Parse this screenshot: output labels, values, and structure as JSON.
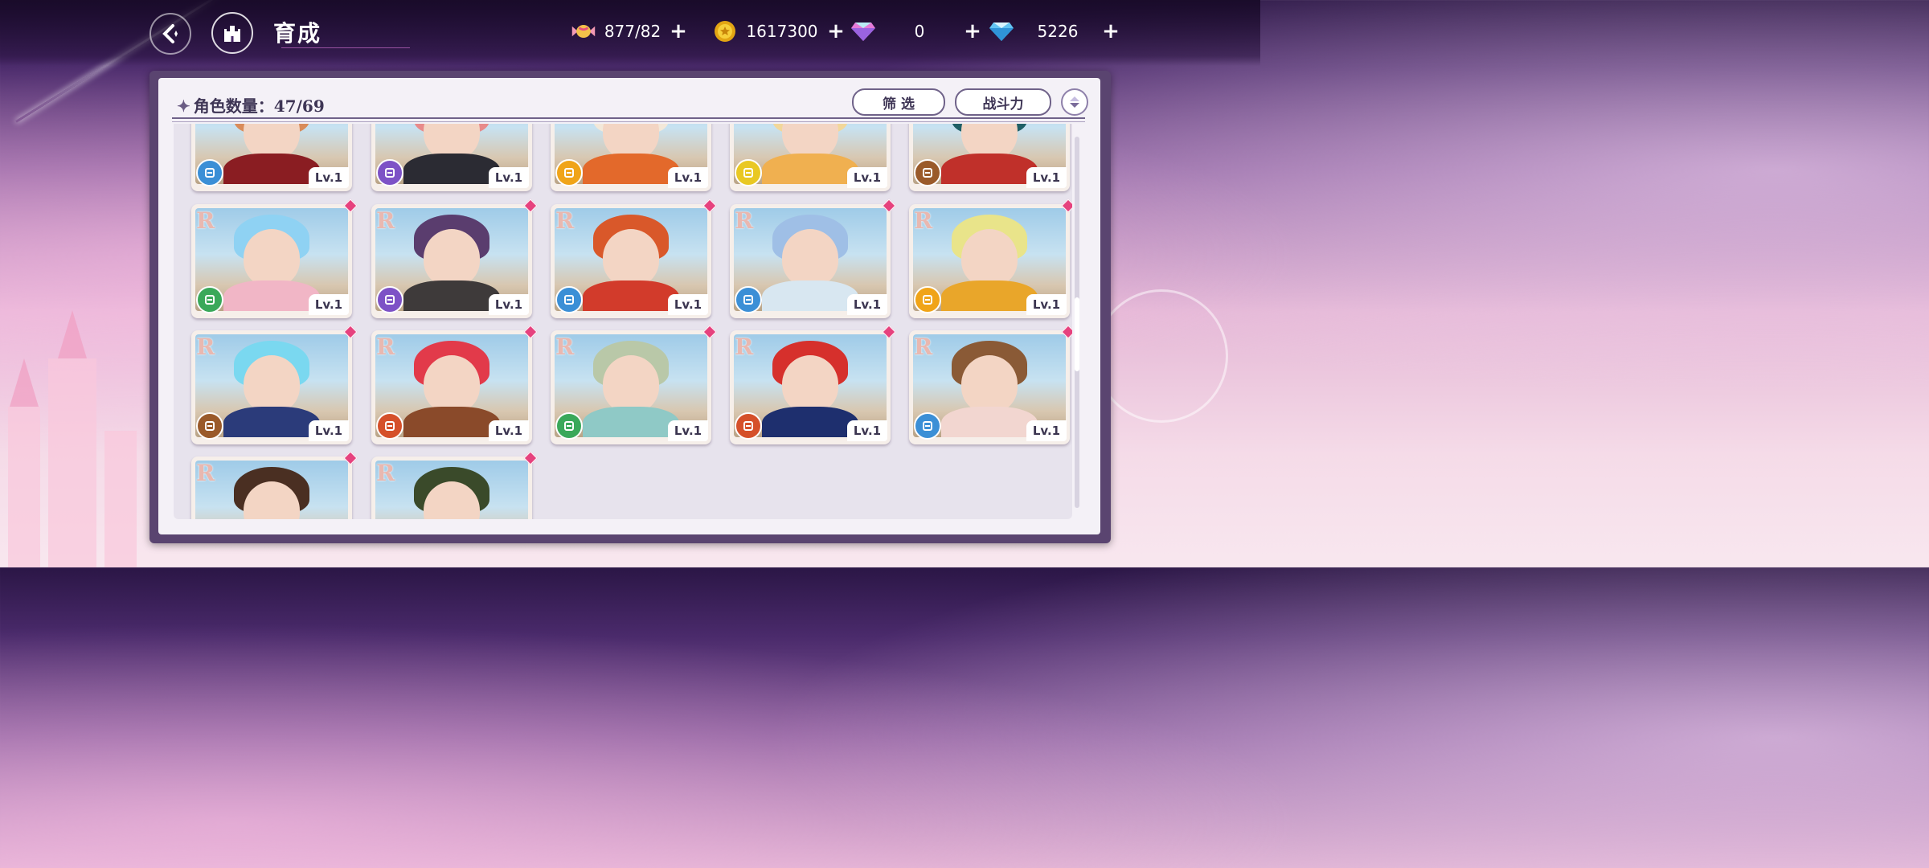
{
  "header": {
    "title": "育成",
    "resources": [
      {
        "name": "stamina",
        "icon": "candy-icon",
        "value": "877/82"
      },
      {
        "name": "gold",
        "icon": "coin-icon",
        "value": "1617300"
      },
      {
        "name": "paid_gem",
        "icon": "pink-diamond-icon",
        "value": "0"
      },
      {
        "name": "free_gem",
        "icon": "blue-diamond-icon",
        "value": "5226"
      }
    ]
  },
  "panel": {
    "count_label": "角色数量：47/69",
    "filter_label": "筛 选",
    "sort_label": "战斗力"
  },
  "cards": [
    {
      "rarity": "",
      "level": "Lv.1",
      "class_color": "#3b8fd6",
      "hair": "#d98b5a",
      "outfit": "#8a1d22",
      "new": false
    },
    {
      "rarity": "",
      "level": "Lv.1",
      "class_color": "#7d52c6",
      "hair": "#e88a8a",
      "outfit": "#2b2b33",
      "new": false
    },
    {
      "rarity": "",
      "level": "Lv.1",
      "class_color": "#f0a418",
      "hair": "#f3e8d9",
      "outfit": "#e3692b",
      "new": false
    },
    {
      "rarity": "",
      "level": "Lv.1",
      "class_color": "#e9c823",
      "hair": "#f2d79a",
      "outfit": "#f0b050",
      "new": false
    },
    {
      "rarity": "",
      "level": "Lv.1",
      "class_color": "#9a5a2a",
      "hair": "#1f5f66",
      "outfit": "#c0302a",
      "new": false
    },
    {
      "rarity": "R",
      "level": "Lv.1",
      "class_color": "#3aa85a",
      "hair": "#8fd2f3",
      "outfit": "#f1b6c6",
      "new": true
    },
    {
      "rarity": "R",
      "level": "Lv.1",
      "class_color": "#7d52c6",
      "hair": "#5a3d6e",
      "outfit": "#3e3a3a",
      "new": true
    },
    {
      "rarity": "R",
      "level": "Lv.1",
      "class_color": "#3b8fd6",
      "hair": "#d9582a",
      "outfit": "#d23b2b",
      "new": true
    },
    {
      "rarity": "R",
      "level": "Lv.1",
      "class_color": "#3b8fd6",
      "hair": "#9fbfe6",
      "outfit": "#d8e7f1",
      "new": true
    },
    {
      "rarity": "R",
      "level": "Lv.1",
      "class_color": "#f0a418",
      "hair": "#e9e48a",
      "outfit": "#e9a62a",
      "new": true
    },
    {
      "rarity": "R",
      "level": "Lv.1",
      "class_color": "#9a5a2a",
      "hair": "#7ad8f0",
      "outfit": "#2b3b7a",
      "new": true
    },
    {
      "rarity": "R",
      "level": "Lv.1",
      "class_color": "#d5502a",
      "hair": "#e23a4a",
      "outfit": "#8a4a2a",
      "new": true
    },
    {
      "rarity": "R",
      "level": "Lv.1",
      "class_color": "#3aa85a",
      "hair": "#b9c8a8",
      "outfit": "#8fc9c6",
      "new": true
    },
    {
      "rarity": "R",
      "level": "Lv.1",
      "class_color": "#d5502a",
      "hair": "#d6302c",
      "outfit": "#1e2f6e",
      "new": true
    },
    {
      "rarity": "R",
      "level": "Lv.1",
      "class_color": "#3b8fd6",
      "hair": "#8a5a36",
      "outfit": "#f2d6d0",
      "new": true
    },
    {
      "rarity": "R",
      "level": "",
      "class_color": "",
      "hair": "#4a2f22",
      "outfit": "#f3e3d6",
      "new": true
    },
    {
      "rarity": "R",
      "level": "",
      "class_color": "",
      "hair": "#3a4a2a",
      "outfit": "#6a4a3a",
      "new": true
    }
  ]
}
